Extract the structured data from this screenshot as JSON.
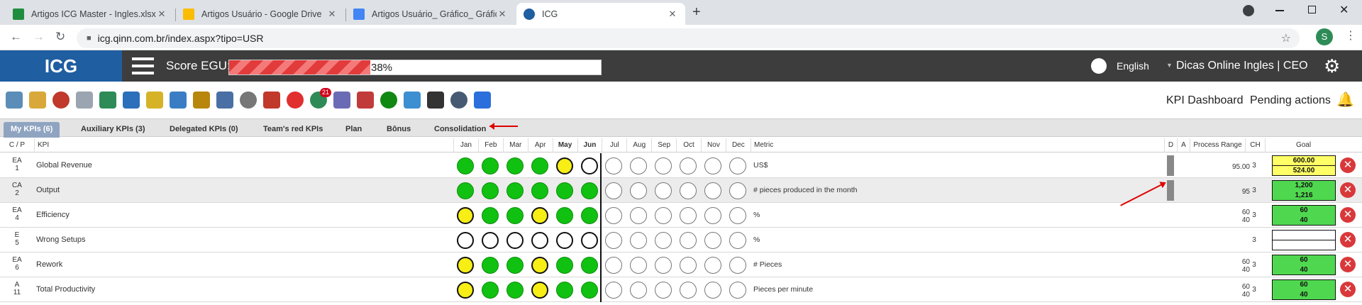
{
  "browser": {
    "tabs": [
      {
        "title": "Artigos ICG Master - Ingles.xlsx - ",
        "favicon_color": "#1e8e3e"
      },
      {
        "title": "Artigos Usuário - Google Drive",
        "favicon_color": "#fbbc04"
      },
      {
        "title": "Artigos Usuário_ Gráfico_ Gráfico",
        "favicon_color": "#4285f4"
      },
      {
        "title": "ICG",
        "favicon_color": "#1f5ea0"
      }
    ],
    "close_glyph": "✕",
    "new_tab_glyph": "+",
    "url": "icg.qinn.com.br/index.aspx?tipo=USR",
    "profile_initial": "S"
  },
  "header": {
    "logo": "ICG",
    "score_label": "Score EGU:",
    "score_percent_text": "38%",
    "score_value": 0.38,
    "language": "English",
    "user": "Dicas Online Ingles  |  CEO"
  },
  "toolbar": {
    "icons": [
      "edit-icon",
      "note-icon",
      "target-icon",
      "clipboard-icon",
      "list-icon",
      "chart-icon",
      "attach-icon",
      "team-icon",
      "award-icon",
      "calendar-icon",
      "timer-icon",
      "org-chart-icon",
      "crosshair-icon",
      "check-badge-icon",
      "docs-icon",
      "pdf-icon",
      "toggle-icon",
      "presentation-icon",
      "apps-grid-icon",
      "help-icon",
      "rocket-icon"
    ],
    "badge_count": "21",
    "kpi_dashboard": "KPI Dashboard",
    "pending_actions": "Pending actions"
  },
  "subtabs": [
    "My KPIs (6)",
    "Auxiliary KPIs (3)",
    "Delegated KPIs (0)",
    "Team's red KPIs",
    "Plan",
    "Bônus",
    "Consolidation"
  ],
  "table": {
    "headers": {
      "cp": "C / P",
      "kpi": "KPI",
      "months": [
        "Jan",
        "Feb",
        "Mar",
        "Apr",
        "May",
        "Jun",
        "Jul",
        "Aug",
        "Sep",
        "Oct",
        "Nov",
        "Dec"
      ],
      "metric": "Metric",
      "d": "D",
      "a": "A",
      "range": "Process Range",
      "ch": "CH",
      "goal": "Goal"
    },
    "rows": [
      {
        "cp1": "EA",
        "cp2": "1",
        "kpi": "Global Revenue",
        "status": [
          "g",
          "g",
          "g",
          "g",
          "y",
          "o",
          "e",
          "e",
          "e",
          "e",
          "e",
          "e"
        ],
        "metric": "US$",
        "has_d": true,
        "range1": "",
        "range2": "95.00",
        "ch": "3",
        "goal_style": "yel",
        "goal1": "600.00",
        "goal2": "524.00"
      },
      {
        "cp1": "CA",
        "cp2": "2",
        "kpi": "Output",
        "status": [
          "g",
          "g",
          "g",
          "g",
          "g",
          "g",
          "e",
          "e",
          "e",
          "e",
          "e",
          "e"
        ],
        "metric": "# pieces produced in the month",
        "has_d": true,
        "range1": "",
        "range2": "95",
        "ch": "3",
        "goal_style": "grn",
        "goal1": "1,200",
        "goal2": "1,216"
      },
      {
        "cp1": "EA",
        "cp2": "4",
        "kpi": "Efficiency",
        "status": [
          "y",
          "g",
          "g",
          "y",
          "g",
          "g",
          "e",
          "e",
          "e",
          "e",
          "e",
          "e"
        ],
        "metric": "%",
        "has_d": false,
        "range1": "60",
        "range2": "40",
        "ch": "3",
        "goal_style": "grn",
        "goal1": "60",
        "goal2": "40"
      },
      {
        "cp1": "E",
        "cp2": "5",
        "kpi": "Wrong Setups",
        "status": [
          "o",
          "o",
          "o",
          "o",
          "o",
          "o",
          "e",
          "e",
          "e",
          "e",
          "e",
          "e"
        ],
        "metric": "%",
        "has_d": false,
        "range1": "",
        "range2": "",
        "ch": "3",
        "goal_style": "wht",
        "goal1": "",
        "goal2": ""
      },
      {
        "cp1": "EA",
        "cp2": "6",
        "kpi": "Rework",
        "status": [
          "y",
          "g",
          "g",
          "y",
          "g",
          "g",
          "e",
          "e",
          "e",
          "e",
          "e",
          "e"
        ],
        "metric": "# Pieces",
        "has_d": false,
        "range1": "60",
        "range2": "40",
        "ch": "3",
        "goal_style": "grn",
        "goal1": "60",
        "goal2": "40"
      },
      {
        "cp1": "A",
        "cp2": "11",
        "kpi": "Total Productivity",
        "status": [
          "y",
          "g",
          "g",
          "y",
          "g",
          "g",
          "e",
          "e",
          "e",
          "e",
          "e",
          "e"
        ],
        "metric": "Pieces per minute",
        "has_d": false,
        "range1": "60",
        "range2": "40",
        "ch": "3",
        "goal_style": "grn",
        "goal1": "60",
        "goal2": "40"
      }
    ],
    "delete_glyph": "✕"
  }
}
